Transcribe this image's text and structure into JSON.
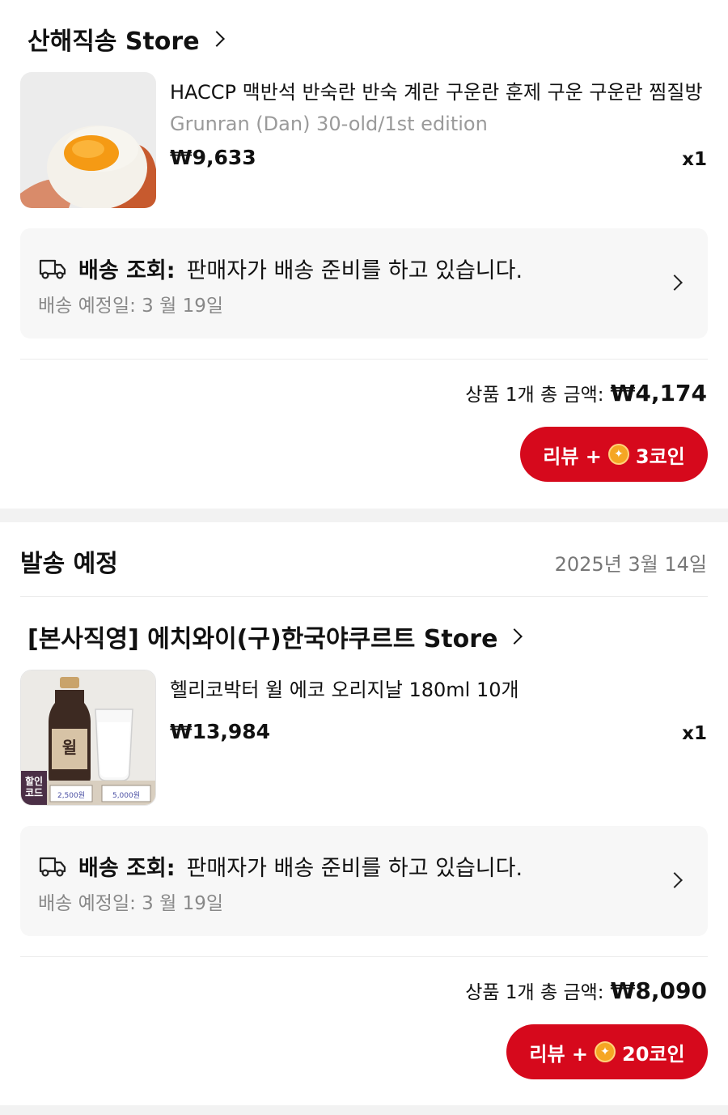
{
  "order1": {
    "store_name": "산해직송 Store",
    "product_name": "HACCP 맥반석 반숙란 반숙 계란 구운란 훈제 구운 구운란 찜질방",
    "product_option": "Grunran (Dan) 30-old/1st edition",
    "price": "₩9,633",
    "quantity": "x1",
    "shipping_label": "배송 조회:",
    "shipping_message": "판매자가 배송 준비를 하고 있습니다.",
    "shipping_eta": "배송 예정일: 3 월 19일",
    "total_label": "상품 1개 총 금액:",
    "total_value": "₩4,174",
    "review_prefix": "리뷰 +",
    "review_reward": "3코인"
  },
  "section2": {
    "title": "발송 예정",
    "date": "2025년 3월 14일"
  },
  "order2": {
    "store_name": "[본사직영] 에치와이(구)한국야쿠르트 Store",
    "product_name": "헬리코박터 윌 에코 오리지날 180ml 10개",
    "price": "₩13,984",
    "quantity": "x1",
    "thumb_badge": "할인\n코드",
    "shipping_label": "배송 조회:",
    "shipping_message": "판매자가 배송 준비를 하고 있습니다.",
    "shipping_eta": "배송 예정일: 3 월 19일",
    "total_label": "상품 1개 총 금액:",
    "total_value": "₩8,090",
    "review_prefix": "리뷰 +",
    "review_reward": "20코인"
  },
  "icons": {
    "truck": "truck-icon",
    "chevron": "chevron-right-icon",
    "coin": "coin-icon"
  },
  "colors": {
    "accent": "#d6091c",
    "coin": "#f5a623",
    "card_bg": "#f7f7f7",
    "muted_text": "#888888"
  }
}
